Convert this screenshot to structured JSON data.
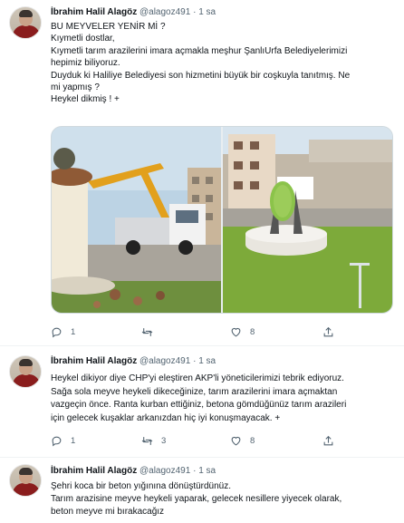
{
  "tweets": [
    {
      "name": "İbrahim Halil Alagöz",
      "handle": "@alagoz491",
      "time": "1 sa",
      "lines": [
        "BU MEYVELER YENİR Mİ ?",
        "Kıymetli dostlar,",
        "Kıymetli tarım arazilerini imara açmakla meşhur ŞanlıUrfa Belediyelerimizi",
        "hepimiz biliyoruz.",
        "Duyduk ki Haliliye Belediyesi son hizmetini büyük bir coşkuyla tanıtmış. Ne",
        "mi yapmış ?",
        "Heykel dikmiş ! +"
      ],
      "replies": "1",
      "retweets": "",
      "likes": "8"
    },
    {
      "name": "İbrahim Halil Alagöz",
      "handle": "@alagoz491",
      "time": "1 sa",
      "lines": [
        "Heykel dikiyor diye CHP'yi eleştiren AKP'li yöneticilerimizi tebrik ediyoruz.",
        "Sağa sola meyve heykeli dikeceğinize, tarım arazilerini imara açmaktan",
        "vazgeçin önce. Ranta kurban ettiğiniz, betona gömdüğünüz tarım arazileri",
        "için gelecek kuşaklar arkanızdan hiç iyi konuşmayacak. +"
      ],
      "replies": "1",
      "retweets": "3",
      "likes": "8"
    },
    {
      "name": "İbrahim Halil Alagöz",
      "handle": "@alagoz491",
      "time": "1 sa",
      "lines": [
        "Şehri koca bir beton yığınına dönüştürdünüz.",
        "Tarım arazisine meyve heykeli yaparak, gelecek nesillere yiyecek olarak,",
        "beton meyve mi bırakacağız"
      ]
    }
  ],
  "separator": "·",
  "icons": {
    "reply": "reply-icon",
    "retweet": "retweet-icon",
    "like": "heart-icon",
    "share": "share-icon"
  },
  "colors": {
    "text": "#0f1419",
    "secondary": "#536471",
    "border": "#cfd9de"
  }
}
